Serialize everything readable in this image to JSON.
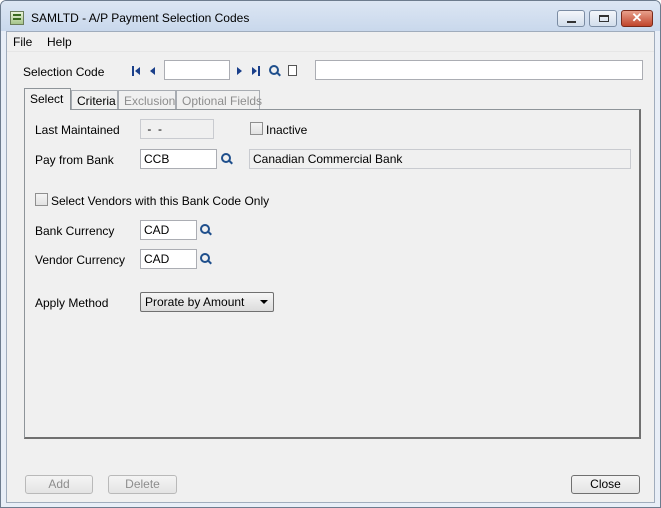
{
  "window": {
    "title": "SAMLTD - A/P Payment Selection Codes",
    "controls": {
      "minimize": "minimize",
      "maximize": "maximize",
      "close": "✕"
    }
  },
  "menu": [
    {
      "label": "File"
    },
    {
      "label": "Help"
    }
  ],
  "selection_code": {
    "label": "Selection Code",
    "value": "",
    "description": ""
  },
  "tabs": [
    {
      "label": "Select",
      "state": "active"
    },
    {
      "label": "Criteria",
      "state": "enabled"
    },
    {
      "label": "Exclusion",
      "state": "disabled"
    },
    {
      "label": "Optional Fields",
      "state": "disabled"
    }
  ],
  "select_tab": {
    "last_maintained": {
      "label": "Last Maintained",
      "value": " -  -"
    },
    "inactive": {
      "label": "Inactive",
      "checked": false
    },
    "pay_from_bank": {
      "label": "Pay from Bank",
      "value": "CCB",
      "description": "Canadian Commercial Bank"
    },
    "vendors_bank_only": {
      "label": "Select Vendors with this Bank Code Only",
      "checked": false
    },
    "bank_currency": {
      "label": "Bank Currency",
      "value": "CAD"
    },
    "vendor_currency": {
      "label": "Vendor Currency",
      "value": "CAD"
    },
    "apply_method": {
      "label": "Apply Method",
      "value": "Prorate by Amount"
    }
  },
  "buttons": {
    "add": "Add",
    "delete": "Delete",
    "close": "Close"
  }
}
